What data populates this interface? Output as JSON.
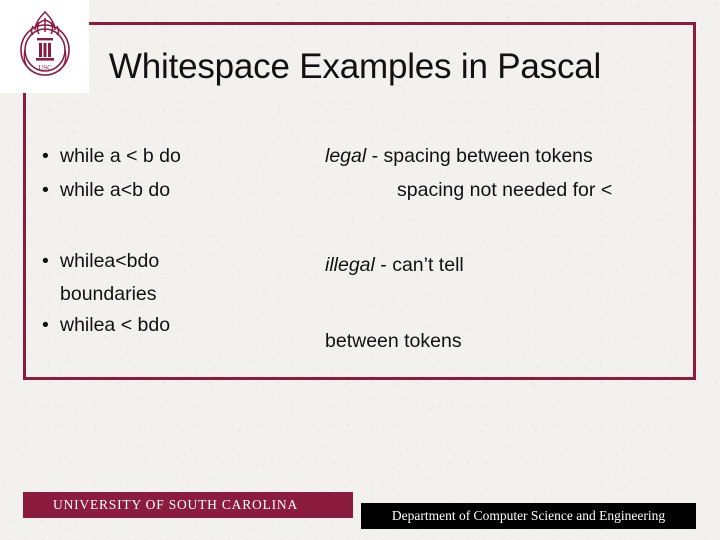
{
  "slide": {
    "title": "Whitespace Examples in Pascal",
    "accent_color": "#8b1c3f",
    "background_color": "#f3f1ee"
  },
  "seal": {
    "name": "university-seal",
    "text": "USC"
  },
  "left_column": {
    "bullet_char": "•",
    "items": [
      {
        "text": "while  a  <  b  do"
      },
      {
        "text": "while  a<b  do"
      },
      {
        "text": "whilea<bdo",
        "continuation": "boundaries"
      },
      {
        "text": "whilea  <  bdo"
      }
    ]
  },
  "right_column": {
    "lines": [
      {
        "emphasis": "legal",
        "text": " - spacing between tokens",
        "indent": false
      },
      {
        "emphasis": "",
        "text": "spacing not needed for <",
        "indent": true
      },
      {
        "emphasis": "illegal",
        "text": " - can’t tell",
        "indent": false
      },
      {
        "emphasis": "",
        "text": "between tokens",
        "indent": false
      }
    ]
  },
  "footer": {
    "left": "UNIVERSITY OF SOUTH CAROLINA",
    "right": "Department of Computer Science and Engineering"
  }
}
